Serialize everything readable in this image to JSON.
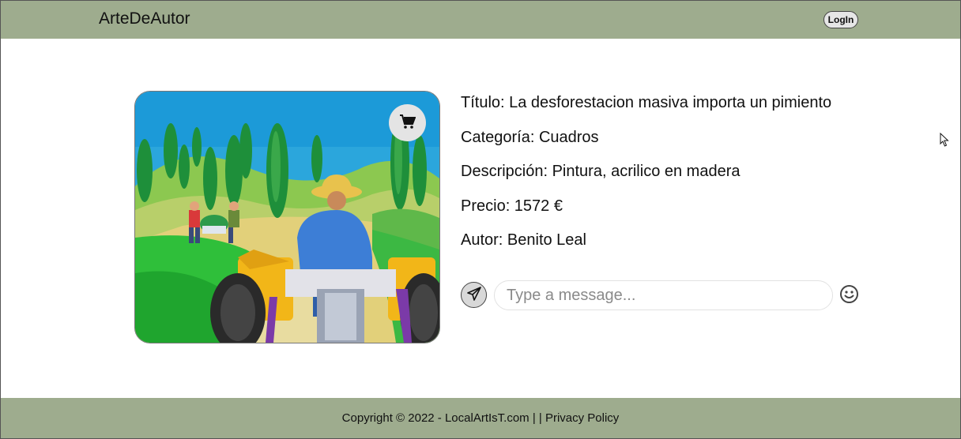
{
  "header": {
    "brand": "ArteDeAutor",
    "login_label": "LogIn"
  },
  "artwork": {
    "image_subject": "painting of a farmer driving a tractor between cypress trees",
    "cart_icon": "shopping-cart-icon"
  },
  "details": {
    "title": "Título: La desforestacion masiva importa un pimiento",
    "category": "Categoría: Cuadros",
    "description": "Descripción: Pintura, acrilico en madera",
    "price": "Precio: 1572 €",
    "author": "Autor: Benito Leal"
  },
  "chat": {
    "send_icon": "paper-plane-icon",
    "placeholder": "Type a message...",
    "value": "",
    "emoji_icon": "smiley-icon"
  },
  "footer": {
    "copyright": "Copyright © 2022 - LocalArtIsT.com",
    "separator": " | | ",
    "privacy_link": "Privacy Policy"
  },
  "colors": {
    "header_footer_bg": "#9eac8e",
    "button_bg": "#e4e4e4"
  }
}
